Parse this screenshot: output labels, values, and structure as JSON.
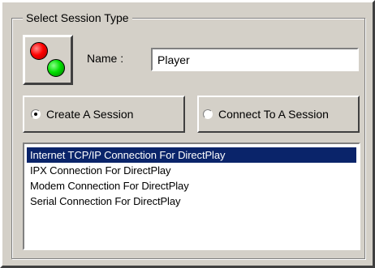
{
  "dialog": {
    "group_title": "Select Session Type",
    "icon": "network-session-icon",
    "name_label": "Name :",
    "name_value": "Player",
    "session_options": [
      {
        "label": "Create A Session",
        "checked": true
      },
      {
        "label": "Connect To A Session",
        "checked": false
      }
    ],
    "connections": [
      {
        "label": "Internet TCP/IP Connection For DirectPlay",
        "selected": true
      },
      {
        "label": "IPX Connection For DirectPlay",
        "selected": false
      },
      {
        "label": "Modem Connection For DirectPlay",
        "selected": false
      },
      {
        "label": "Serial Connection For DirectPlay",
        "selected": false
      }
    ]
  },
  "colors": {
    "face": "#d4d0c8",
    "selection": "#0a246a"
  }
}
